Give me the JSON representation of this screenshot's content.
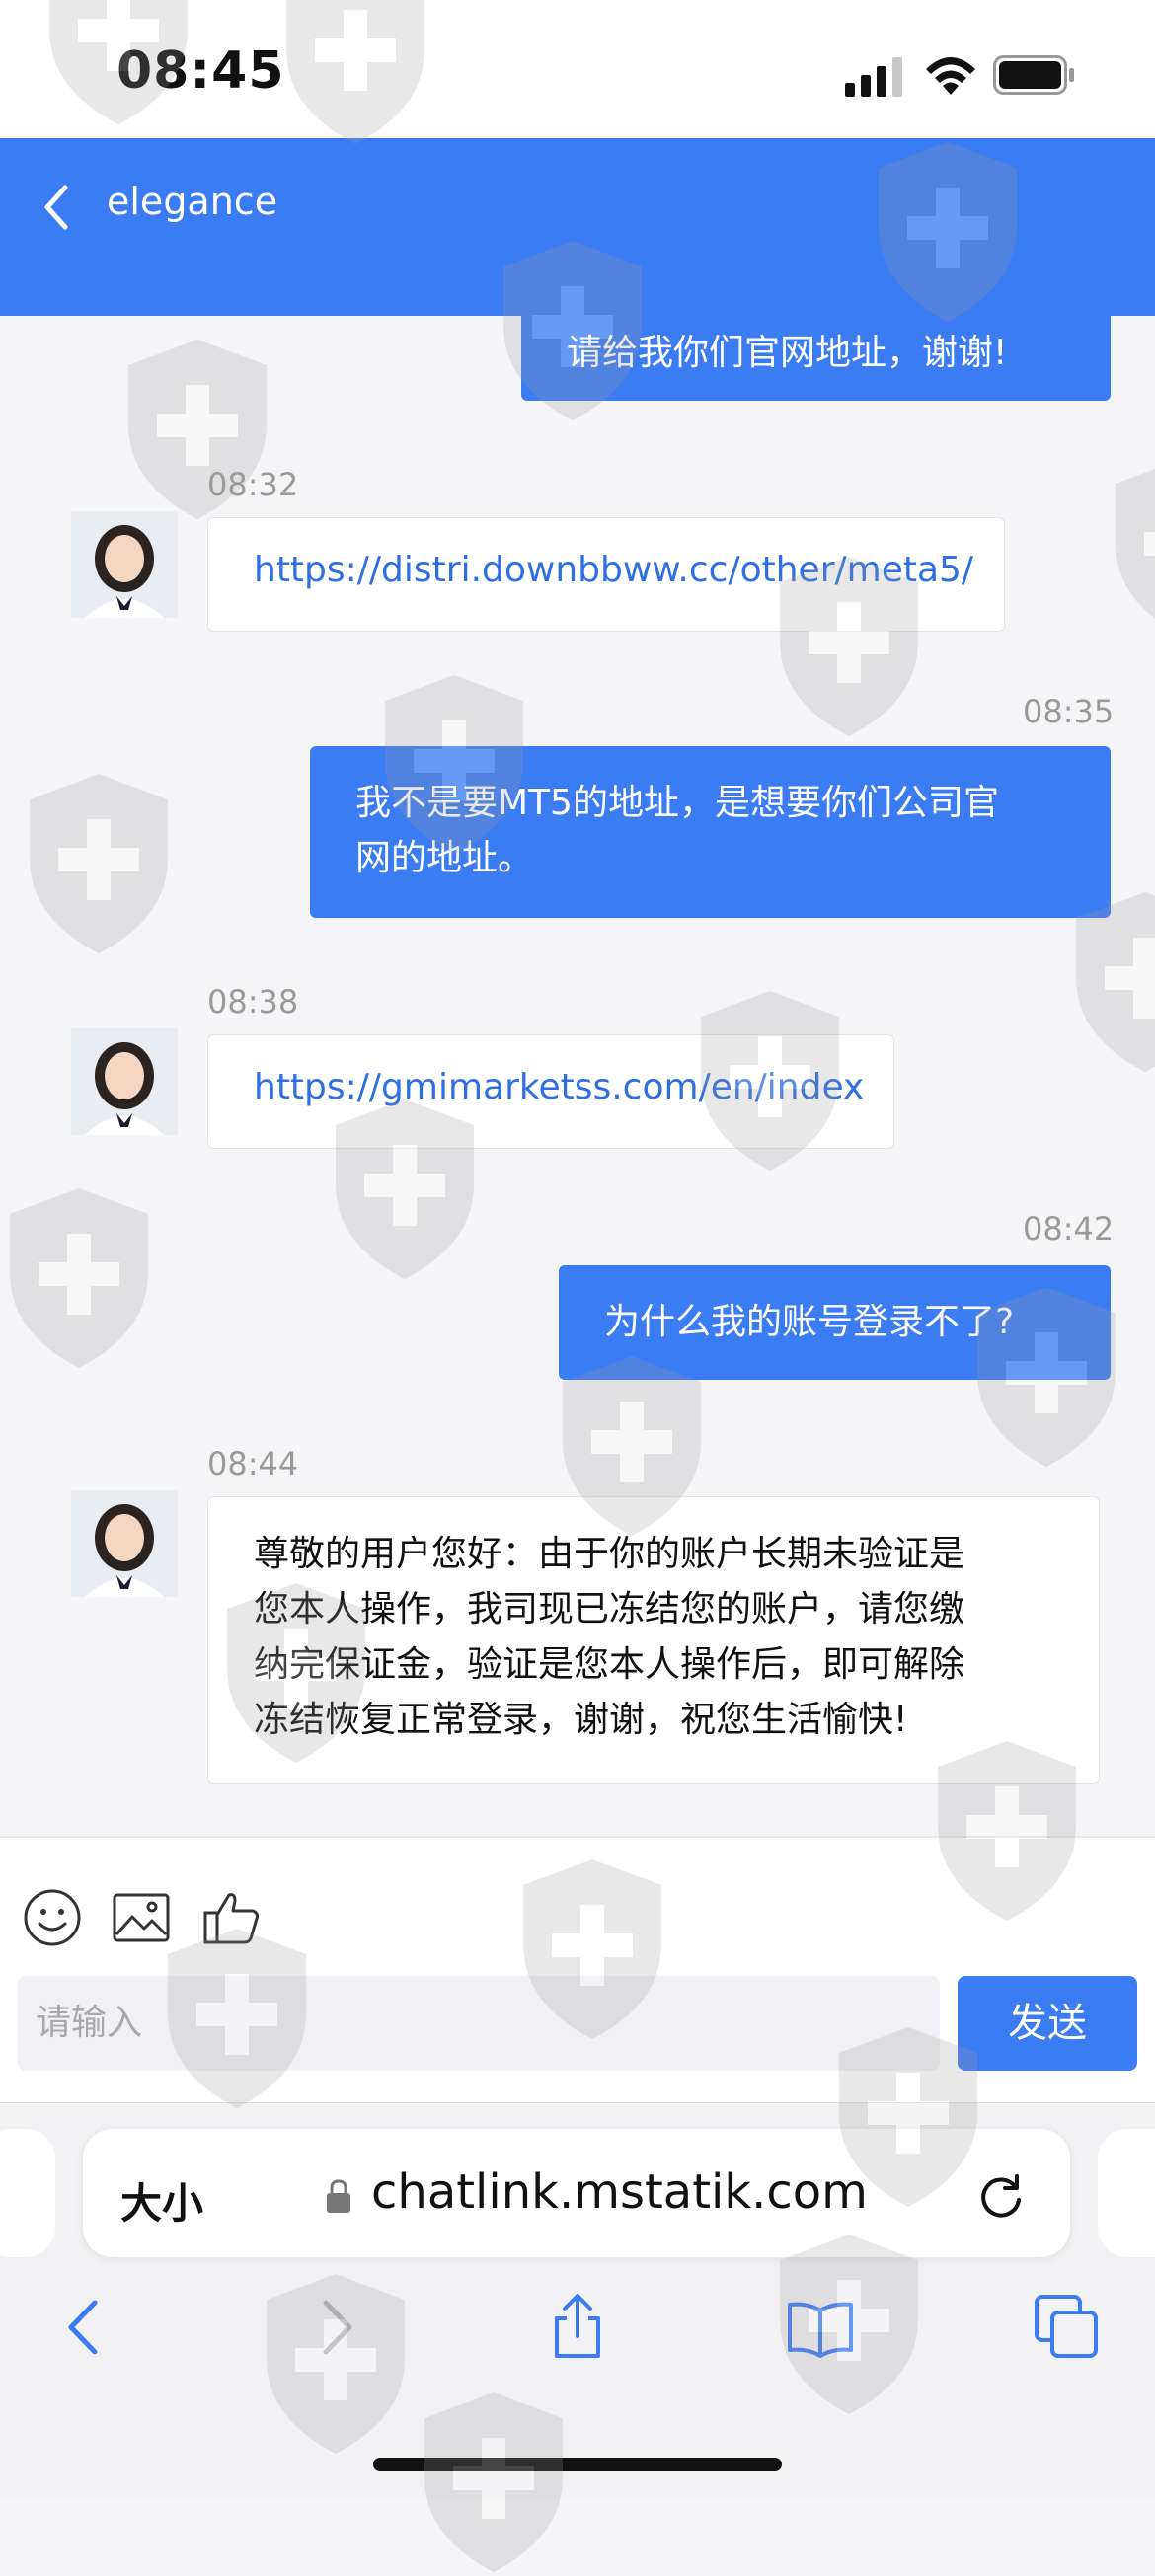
{
  "status_bar": {
    "time": "08:45"
  },
  "header": {
    "title": "elegance"
  },
  "messages": [
    {
      "direction": "out",
      "time": "",
      "text": "请给我你们官网地址，谢谢!"
    },
    {
      "direction": "in",
      "time": "08:32",
      "text": "https://distri.downbbww.cc/other/meta5/",
      "is_link": true
    },
    {
      "direction": "out",
      "time": "08:35",
      "lines": [
        "我不是要MT5的地址，是想要你们公司官",
        "网的地址。"
      ]
    },
    {
      "direction": "in",
      "time": "08:38",
      "text": "https://gmimarketss.com/en/index",
      "is_link": true
    },
    {
      "direction": "out",
      "time": "08:42",
      "text": "为什么我的账号登录不了?"
    },
    {
      "direction": "in",
      "time": "08:44",
      "lines": [
        "尊敬的用户您好：由于你的账户长期未验证是",
        "您本人操作，我司现已冻结您的账户，请您缴",
        "纳完保证金，验证是您本人操作后，即可解除",
        "冻结恢复正常登录，谢谢，祝您生活愉快!"
      ]
    }
  ],
  "input": {
    "placeholder": "请输入",
    "send_label": "发送"
  },
  "toolbar_icons": [
    "emoji-icon",
    "image-icon",
    "thumbs-up-icon"
  ],
  "browser": {
    "text_size_label": "大小",
    "url": "chatlink.mstatik.com"
  },
  "colors": {
    "accent": "#3b7cf2",
    "link": "#2f6fe3",
    "timestamp": "#9a9a9a"
  }
}
